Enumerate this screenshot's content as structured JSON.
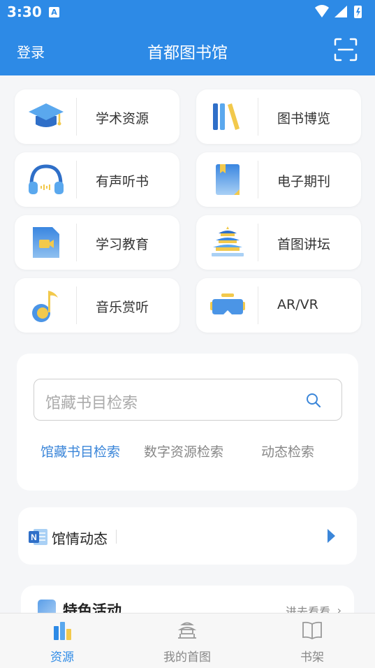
{
  "status_bar": {
    "time": "3:30",
    "notification_icon": "A"
  },
  "header": {
    "login_label": "登录",
    "title": "首都图书馆",
    "scan_icon": "scan-icon"
  },
  "categories": [
    {
      "label": "学术资源",
      "icon": "graduation-cap-icon"
    },
    {
      "label": "图书博览",
      "icon": "books-icon"
    },
    {
      "label": "有声听书",
      "icon": "headphones-icon"
    },
    {
      "label": "电子期刊",
      "icon": "journal-icon"
    },
    {
      "label": "学习教育",
      "icon": "video-file-icon"
    },
    {
      "label": "首图讲坛",
      "icon": "temple-icon"
    },
    {
      "label": "音乐赏听",
      "icon": "music-note-icon"
    },
    {
      "label": "AR/VR",
      "icon": "vr-headset-icon"
    }
  ],
  "search": {
    "placeholder": "馆藏书目检索",
    "tabs": [
      "馆藏书目检索",
      "数字资源检索",
      "动态检索"
    ],
    "active_tab": 0
  },
  "news": {
    "label": "馆情动态"
  },
  "activity": {
    "label": "特色活动",
    "more_label": "进去看看"
  },
  "tab_bar": {
    "items": [
      {
        "label": "资源",
        "icon": "resource-bars-icon",
        "active": true
      },
      {
        "label": "我的首图",
        "icon": "temple-icon",
        "active": false
      },
      {
        "label": "书架",
        "icon": "open-book-icon",
        "active": false
      }
    ]
  },
  "colors": {
    "primary": "#2d8ae6",
    "accent_text": "#3b86d9",
    "background": "#f5f6f8"
  }
}
